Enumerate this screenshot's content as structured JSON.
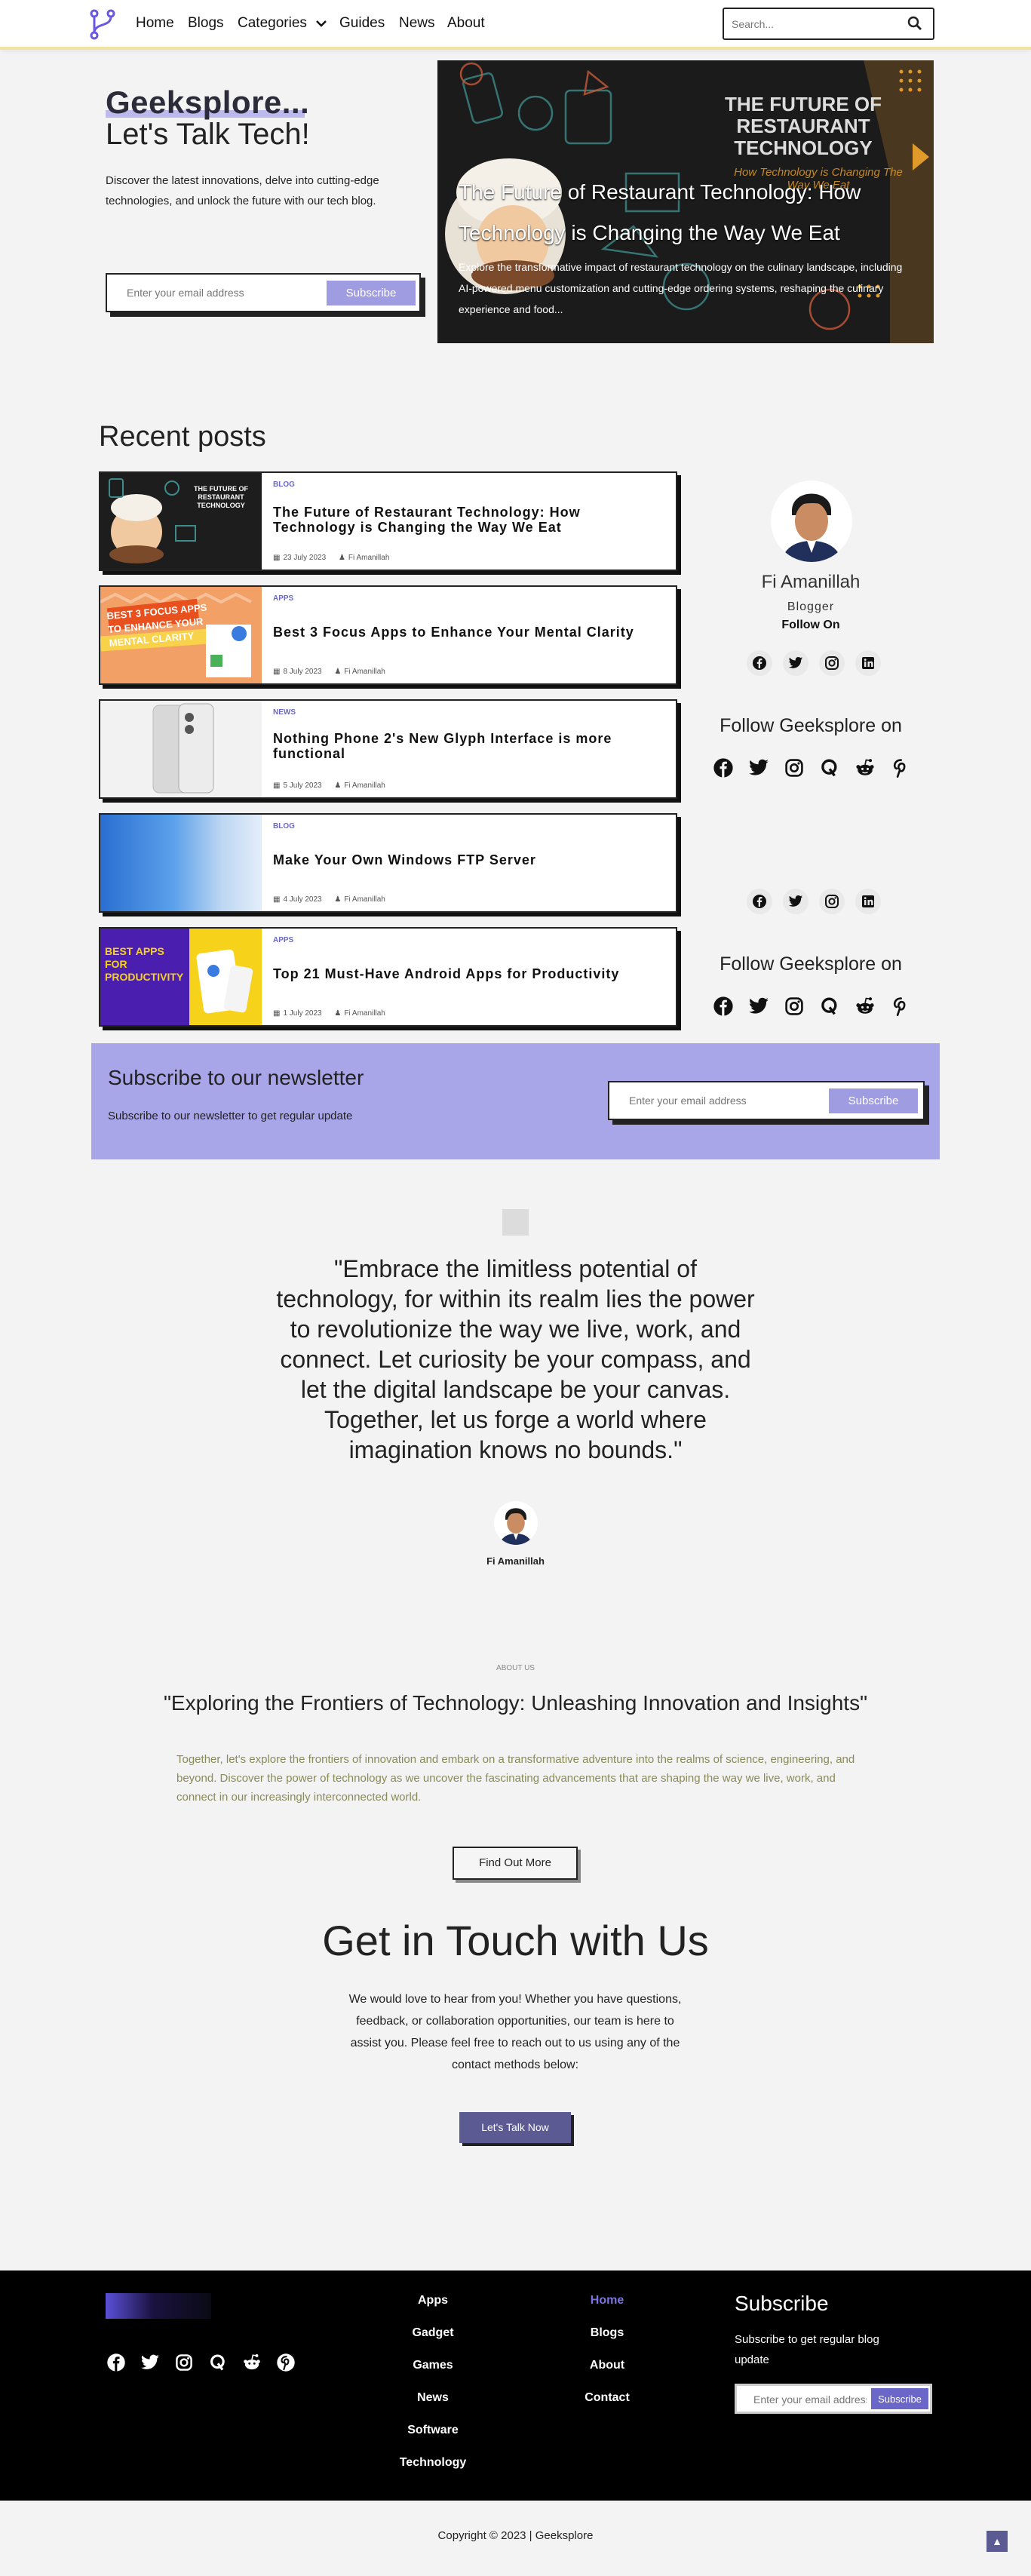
{
  "nav": {
    "items": [
      "Home",
      "Blogs",
      "Categories",
      "Guides",
      "News",
      "About"
    ],
    "search_placeholder": "Search..."
  },
  "hero": {
    "brand": "Geeksplore...",
    "tagline": "Let's Talk Tech!",
    "description": "Discover the latest innovations, delve into cutting-edge technologies, and unlock the future with our tech blog.",
    "email_placeholder": "Enter your email address",
    "subscribe_label": "Subscribe",
    "featured": {
      "image_text": "THE FUTURE OF RESTAURANT TECHNOLOGY",
      "image_subtext": "How Technology is Changing The Way We Eat",
      "title": "The Future of Restaurant Technology: How Technology is Changing the Way We Eat",
      "excerpt": "Explore the transformative impact of restaurant technology on the culinary landscape, including AI-powered menu customization and cutting-edge ordering systems, reshaping the culinary experience and food..."
    }
  },
  "recent": {
    "heading": "Recent posts",
    "posts": [
      {
        "category": "BLOG",
        "title": "The Future of Restaurant Technology: How Technology is Changing the Way We Eat",
        "date": "23 July 2023",
        "author": "Fi Amanillah",
        "thumb_text": "THE FUTURE OF RESTAURANT TECHNOLOGY"
      },
      {
        "category": "APPS",
        "title": "Best 3 Focus Apps to Enhance Your Mental Clarity",
        "date": "8 July 2023",
        "author": "Fi Amanillah",
        "thumb_text": "BEST 3 FOCUS APPS TO ENHANCE YOUR MENTAL CLARITY"
      },
      {
        "category": "NEWS",
        "title": "Nothing Phone 2's New Glyph Interface is more functional",
        "date": "5 July 2023",
        "author": "Fi Amanillah",
        "thumb_text": ""
      },
      {
        "category": "BLOG",
        "title": "Make Your Own Windows FTP Server",
        "date": "4 July 2023",
        "author": "Fi Amanillah",
        "thumb_text": ""
      },
      {
        "category": "APPS",
        "title": "Top 21 Must-Have Android Apps for Productivity",
        "date": "1 July 2023",
        "author": "Fi Amanillah",
        "thumb_text": "BEST APPS FOR PRODUCTIVITY"
      }
    ]
  },
  "sidebar": {
    "author_name": "Fi Amanillah",
    "author_role": "Blogger",
    "follow_on": "Follow On",
    "follow_geeksplore": "Follow Geeksplore on",
    "author_socials": [
      "facebook-icon",
      "twitter-icon",
      "instagram-icon",
      "linkedin-icon"
    ],
    "site_socials": [
      "facebook-icon",
      "twitter-icon",
      "instagram-icon",
      "quora-icon",
      "reddit-icon",
      "pinterest-icon"
    ]
  },
  "newsletter": {
    "heading": "Subscribe to our newsletter",
    "text": "Subscribe to our newsletter to get regular update",
    "email_placeholder": "Enter your email address",
    "subscribe_label": "Subscribe"
  },
  "quote": {
    "text": "\"Embrace the limitless potential of technology, for within its realm lies the power to revolutionize the way we live, work, and connect. Let curiosity be your compass, and let the digital landscape be your canvas. Together, let us forge a world where imagination knows no bounds.\"",
    "author": "Fi Amanillah"
  },
  "about": {
    "tag": "ABOUT US",
    "heading": "\"Exploring the Frontiers of Technology: Unleashing Innovation and Insights\"",
    "text": "Together, let's explore the frontiers of innovation and embark on a transformative adventure into the realms of science, engineering, and beyond. Discover the power of technology as we uncover the fascinating advancements that are shaping the way we live, work, and connect in our increasingly interconnected world.",
    "button": "Find Out More"
  },
  "contact": {
    "heading": "Get in Touch with Us",
    "text": "We would love to hear from you! Whether you have questions, feedback, or collaboration opportunities, our team is here to assist you. Please feel free to reach out to us using any of the contact methods below:",
    "button": "Let's Talk Now"
  },
  "footer": {
    "categories": [
      "Apps",
      "Gadget",
      "Games",
      "News",
      "Software",
      "Technology"
    ],
    "links": [
      "Home",
      "Blogs",
      "About",
      "Contact"
    ],
    "subscribe_heading": "Subscribe",
    "subscribe_text": "Subscribe to get regular blog update",
    "email_placeholder": "Enter your email address",
    "subscribe_label": "Subscribe",
    "socials": [
      "facebook-icon",
      "twitter-icon",
      "instagram-icon",
      "quora-icon",
      "reddit-icon",
      "pinterest-icon"
    ],
    "copyright": "Copyright © 2023 | Geeksplore"
  },
  "colors": {
    "accent": "#a9a5e9",
    "button_dark": "#5c5a92",
    "footer_bg": "#000000",
    "active_link": "#7a74e0"
  }
}
